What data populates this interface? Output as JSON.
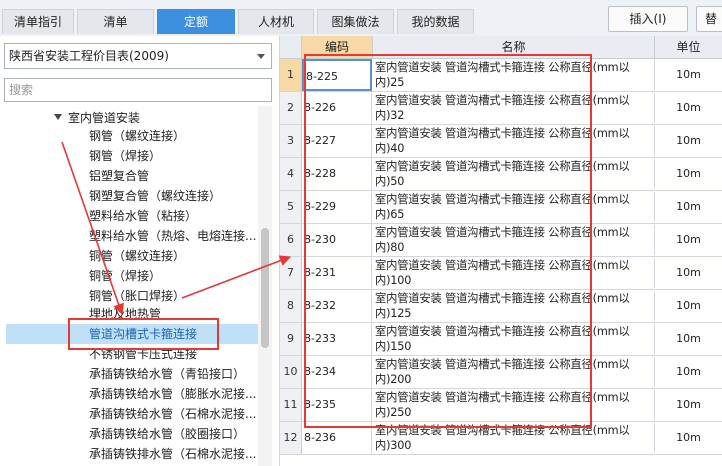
{
  "tabs": [
    {
      "label": "清单指引",
      "active": false
    },
    {
      "label": "清单",
      "active": false
    },
    {
      "label": "定额",
      "active": true
    },
    {
      "label": "人材机",
      "active": false
    },
    {
      "label": "图集做法",
      "active": false
    },
    {
      "label": "我的数据",
      "active": false
    }
  ],
  "toolbar": {
    "insert_label": "插入(I)",
    "next_label": "替"
  },
  "left": {
    "library": "陕西省安装工程价目表(2009)",
    "search_placeholder": "搜索",
    "tree": {
      "parent": "室内管道安装",
      "children": [
        "钢管（螺纹连接）",
        "钢管（焊接）",
        "铝塑复合管",
        "钢塑复合管（螺纹连接）",
        "塑料给水管（粘接）",
        "塑料给水管（热熔、电熔连接...",
        "铜管（螺纹连接）",
        "铜管（焊接）",
        "铜管（胀口焊接）",
        "埋地及地热管",
        "管道沟槽式卡箍连接",
        "不锈钢管卡压式连接",
        "承插铸铁给水管（青铅接口）",
        "承插铸铁给水管（膨胀水泥接...",
        "承插铸铁给水管（石棉水泥接...",
        "承插铸铁给水管（胶圈接口）",
        "承插铸铁排水管（石棉水泥接..."
      ],
      "selected": "管道沟槽式卡箍连接"
    }
  },
  "grid": {
    "headers": {
      "code": "编码",
      "name": "名称",
      "unit": "单位"
    },
    "rows": [
      {
        "num": "1",
        "code": "8-225",
        "name": "室内管道安装 管道沟槽式卡箍连接 公称直径(mm以内)25",
        "unit": "10m"
      },
      {
        "num": "2",
        "code": "8-226",
        "name": "室内管道安装 管道沟槽式卡箍连接 公称直径(mm以内)32",
        "unit": "10m"
      },
      {
        "num": "3",
        "code": "8-227",
        "name": "室内管道安装 管道沟槽式卡箍连接 公称直径(mm以内)40",
        "unit": "10m"
      },
      {
        "num": "4",
        "code": "8-228",
        "name": "室内管道安装 管道沟槽式卡箍连接 公称直径(mm以内)50",
        "unit": "10m"
      },
      {
        "num": "5",
        "code": "8-229",
        "name": "室内管道安装 管道沟槽式卡箍连接 公称直径(mm以内)65",
        "unit": "10m"
      },
      {
        "num": "6",
        "code": "8-230",
        "name": "室内管道安装 管道沟槽式卡箍连接 公称直径(mm以内)80",
        "unit": "10m"
      },
      {
        "num": "7",
        "code": "8-231",
        "name": "室内管道安装 管道沟槽式卡箍连接 公称直径(mm以内)100",
        "unit": "10m"
      },
      {
        "num": "8",
        "code": "8-232",
        "name": "室内管道安装 管道沟槽式卡箍连接 公称直径(mm以内)125",
        "unit": "10m"
      },
      {
        "num": "9",
        "code": "8-233",
        "name": "室内管道安装 管道沟槽式卡箍连接 公称直径(mm以内)150",
        "unit": "10m"
      },
      {
        "num": "10",
        "code": "8-234",
        "name": "室内管道安装 管道沟槽式卡箍连接 公称直径(mm以内)200",
        "unit": "10m"
      },
      {
        "num": "11",
        "code": "8-235",
        "name": "室内管道安装 管道沟槽式卡箍连接 公称直径(mm以内)250",
        "unit": "10m"
      },
      {
        "num": "12",
        "code": "8-236",
        "name": "室内管道安装 管道沟槽式卡箍连接 公称直径(mm以内)300",
        "unit": "10m"
      }
    ]
  },
  "colors": {
    "accent": "#3d8fe0",
    "selected_row": "#bfe0f7",
    "annotation": "#e53935",
    "current_header": "#f6d9a4"
  }
}
